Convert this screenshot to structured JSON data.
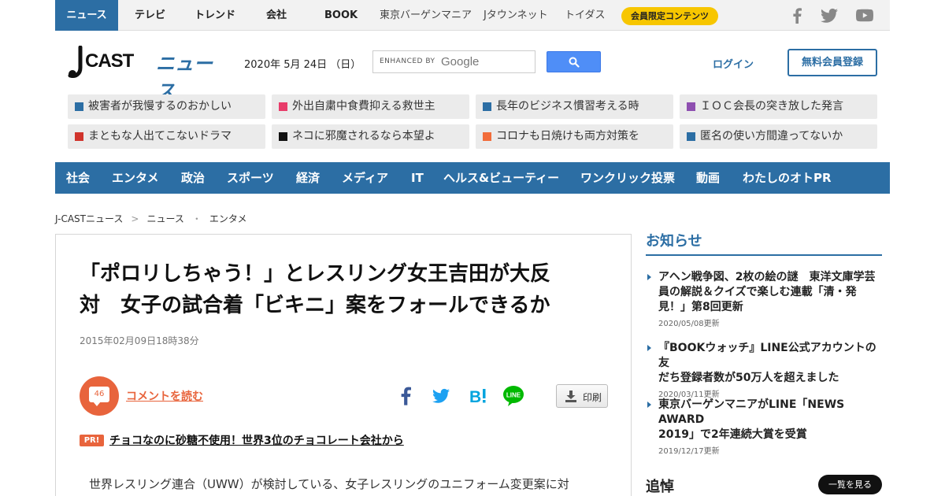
{
  "topnav": {
    "items": [
      {
        "label": "ニュース"
      },
      {
        "label": "テレビ"
      },
      {
        "label": "トレンド"
      },
      {
        "label": "会社"
      },
      {
        "label": "BOOK"
      },
      {
        "label": "東京バーゲンマニア"
      },
      {
        "label": "Jタウンネット"
      },
      {
        "label": "トイダス"
      }
    ],
    "member_badge": "会員限定コンテンツ",
    "social_icons": [
      "facebook-icon",
      "twitter-icon",
      "youtube-icon"
    ]
  },
  "header": {
    "logo_text": "J-CAST",
    "logo_suffix": "ニュース",
    "date": "2020年 5月 24日 （日）",
    "search": {
      "label": "ENHANCED BY",
      "brand": "Google",
      "placeholder": ""
    },
    "login_label": "ログイン",
    "register_label": "無料会員登録"
  },
  "trending": [
    {
      "label": "被害者が我慢するのおかしい",
      "color": "#2c6ea4"
    },
    {
      "label": "外出自粛中食費抑える救世主",
      "color": "#e83c6a"
    },
    {
      "label": "長年のビジネス慣習考える時",
      "color": "#2c6ea4"
    },
    {
      "label": "ＩＯＣ会長の突き放した発言",
      "color": "#8e4fb0"
    },
    {
      "label": "まともな人出てこないドラマ",
      "color": "#d0342c"
    },
    {
      "label": "ネコに邪魔されるなら本望よ",
      "color": "#111111"
    },
    {
      "label": "コロナも日焼けも両方対策を",
      "color": "#f26c3a"
    },
    {
      "label": "匿名の使い方間違ってないか",
      "color": "#2c6ea4"
    }
  ],
  "catnav": [
    {
      "label": "社会"
    },
    {
      "label": "エンタメ"
    },
    {
      "label": "政治"
    },
    {
      "label": "スポーツ"
    },
    {
      "label": "経済"
    },
    {
      "label": "メディア"
    },
    {
      "label": "IT"
    },
    {
      "label": "ヘルス&ビューティー"
    },
    {
      "label": "ワンクリック投票"
    },
    {
      "label": "動画"
    },
    {
      "label": "わたしのオトPR"
    }
  ],
  "breadcrumb": {
    "items": [
      "J-CASTニュース",
      "ニュース",
      "エンタメ"
    ],
    "sep1": ">",
    "sep2": "・"
  },
  "article": {
    "headline_line1": "「ポロリしちゃう！」とレスリング女王吉田が大反",
    "headline_line2": "対　女子の試合着「ビキニ」案をフォールできるか",
    "date": "2015年02月09日18時38分",
    "comment_count": "46",
    "comment_link": "コメントを読む",
    "share_icons": [
      "facebook-icon",
      "twitter-icon",
      "hatena-bookmark-icon",
      "line-icon"
    ],
    "line_label": "LINE",
    "print_label": "印刷",
    "pr_badge": "PR!",
    "pr_link": "チョコなのに砂糖不使用！世界3位のチョコレート会社から",
    "body_start": "世界レスリング連合（UWW）が検討している、女子レスリングのユニフォーム変更案に対"
  },
  "sidebar": {
    "notice_heading": "お知らせ",
    "notices": [
      {
        "title_line1": "アヘン戦争図、2枚の絵の謎　東洋文庫学芸",
        "title_line2": "員の解説＆クイズで楽しむ連載「清・発",
        "title_line3": "見！」第8回更新",
        "date": "2020/05/08更新"
      },
      {
        "title_line1": "『BOOKウォッチ』LINE公式アカウントの友",
        "title_line2": "だち登録者数が50万人を超えました",
        "date": "2020/03/11更新"
      },
      {
        "title_line1": "東京バーゲンマニアがLINE「NEWS AWARD",
        "title_line2": "2019」で2年連続大賞を受賞",
        "date": "2019/12/17更新"
      }
    ],
    "obit_heading": "追悼",
    "obit_more": "一覧を見る"
  },
  "colors": {
    "brand": "#2c6ea4",
    "accent": "#e8643c",
    "badge": "#f7c600"
  }
}
